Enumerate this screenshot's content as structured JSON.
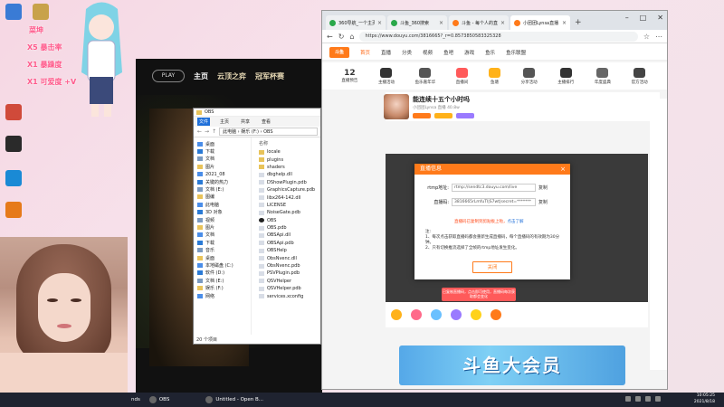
{
  "desktop": {
    "icons": [
      {
        "label": "",
        "color": "#3a7bd5"
      },
      {
        "label": "",
        "color": "#c8a24a"
      },
      {
        "label": "",
        "color": "#d04a3a"
      },
      {
        "label": "",
        "color": "#2a2a2a"
      },
      {
        "label": "",
        "color": "#1a8ad5"
      },
      {
        "label": "",
        "color": "#333333"
      },
      {
        "label": "",
        "color": "#e67a1a"
      }
    ],
    "stickers": [
      "X5 暴击率",
      "X1 暴躁度",
      "X1 可爱度 +V"
    ],
    "sticker_top": "菜坤"
  },
  "game": {
    "play_label": "PLAY",
    "nav": [
      "主页",
      "云顶之弈",
      "冠军杯赛"
    ]
  },
  "explorer": {
    "title": "OBS",
    "ribbon": [
      "文件",
      "主页",
      "共享",
      "查看"
    ],
    "path": "此电脑 › 娱乐 (F:) › OBS",
    "column_header": "名称",
    "sidebar": [
      "桌面",
      "下载",
      "文档",
      "图片",
      "2021_08",
      "关键的热力",
      "文档 (E:)",
      "图编",
      "此电脑",
      "3D 对象",
      "视频",
      "图片",
      "文档",
      "下载",
      "音乐",
      "桌面",
      "本地磁盘 (C:)",
      "软件 (D:)",
      "文档 (E:)",
      "娱乐 (F:)",
      "网络"
    ],
    "files": [
      "locale",
      "plugins",
      "shaders",
      "dbghelp.dll",
      "DShowPlugin.pdb",
      "GraphicsCapture.pdb",
      "libx264-142.dll",
      "LICENSE",
      "NoiseGate.pdb",
      "OBS",
      "OBS.pdb",
      "OBSApi.dll",
      "OBSApi.pdb",
      "OBSHelp",
      "ObsNvenc.dll",
      "ObsNvenc.pdb",
      "PSVPlugin.pdb",
      "QSVHelper",
      "QSVHelper.pdb",
      "services.xconfig"
    ],
    "status": "20 个项目"
  },
  "browser": {
    "tabs": [
      "360导航_一个主页",
      "斗鱼_360搜索",
      "斗鱼 - 每个人的直播",
      "小团团Lynsa直播"
    ],
    "url": "https://www.douyu.com/3816665?_r=0.8573850583325328",
    "site_nav": [
      "斗鱼",
      "首页",
      "直播",
      "分类",
      "视频",
      "鱼吧",
      "游戏",
      "鱼乐",
      "鱼乐联盟"
    ],
    "cats": [
      {
        "num": "12",
        "label": "直播预告"
      },
      {
        "num": "",
        "label": "主播活动"
      },
      {
        "num": "",
        "label": "鱼乐嘉年华"
      },
      {
        "num": "",
        "label": "直播间"
      },
      {
        "num": "",
        "label": "鱼塘"
      },
      {
        "num": "",
        "label": "分享活动"
      },
      {
        "num": "",
        "label": "主播排行"
      },
      {
        "num": "",
        "label": "年度盛典"
      },
      {
        "num": "",
        "label": "官方活动"
      }
    ],
    "room_title": "能连续十五个小时吗",
    "room_sub": "小团团Lynsa  直播  40.8w",
    "promo": "斗鱼大会员"
  },
  "dialog": {
    "title": "直播信息",
    "rtmp_label": "rtmp地址:",
    "rtmp_value": "rtmp://sendtc3.douyu.com/live",
    "code_label": "直播码:",
    "code_value": "3816665rLmfuTI|S7wt|secret=*******",
    "copy": "复制",
    "warn": "直播码已复制到剪贴板上啦，",
    "warn_link": "点击了解",
    "notes_title": "注:",
    "notes": [
      "1、每次点击获取直播码都会重新生成直播码，每个直播码的有效期为30分钟。",
      "2、只有切换推流选择了全帧的rtmp地址发生变化。"
    ],
    "ok": "关闭"
  },
  "danmu": "已复制直播码，点击即可使用，直播码每次获取都会变化",
  "taskbar": {
    "items": [
      "nds",
      "OBS",
      "Untitled - Open B..."
    ],
    "time": "10:05:25",
    "date": "2021/8/18"
  },
  "colors": {
    "accent": "#ff7a1a",
    "taskbar": "#1f2330"
  }
}
